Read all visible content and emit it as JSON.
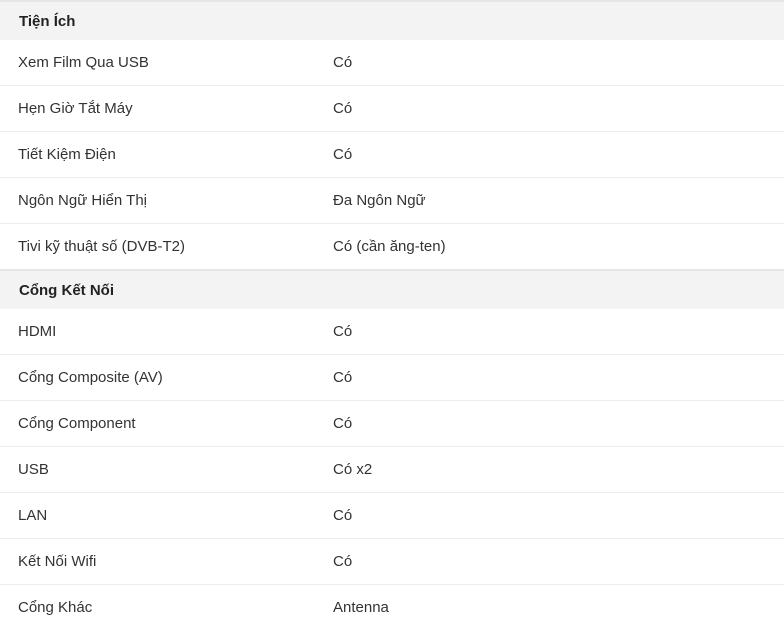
{
  "sections": [
    {
      "title": "Tiện Ích",
      "rows": [
        {
          "label": "Xem Film Qua USB",
          "value": "Có"
        },
        {
          "label": "Hẹn Giờ Tắt Máy",
          "value": "Có"
        },
        {
          "label": "Tiết Kiệm Điện",
          "value": "Có"
        },
        {
          "label": "Ngôn Ngữ Hiển Thị",
          "value": "Đa Ngôn Ngữ"
        },
        {
          "label": "Tivi kỹ thuật số (DVB-T2)",
          "value": "Có (cần ăng-ten)"
        }
      ]
    },
    {
      "title": "Cổng Kết Nối",
      "rows": [
        {
          "label": "HDMI",
          "value": "Có"
        },
        {
          "label": "Cổng Composite (AV)",
          "value": "Có"
        },
        {
          "label": "Cổng Component",
          "value": "Có"
        },
        {
          "label": "USB",
          "value": "Có x2"
        },
        {
          "label": "LAN",
          "value": "Có"
        },
        {
          "label": "Kết Nối Wifi",
          "value": "Có"
        },
        {
          "label": "Cổng Khác",
          "value": "Antenna"
        }
      ]
    }
  ]
}
